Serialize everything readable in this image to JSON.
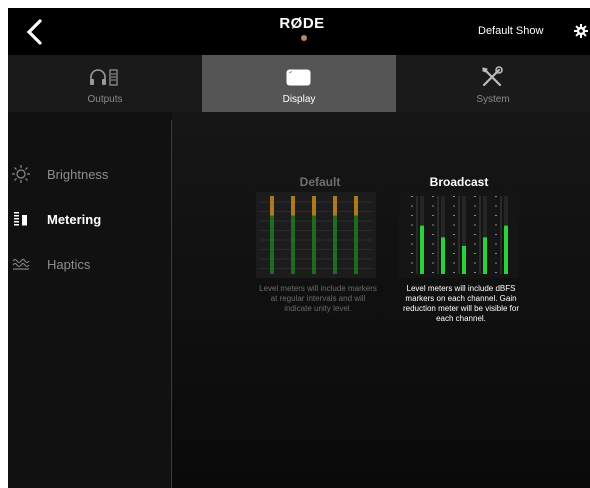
{
  "header": {
    "back_icon": "chevron-left-icon",
    "logo": "RØDE",
    "show_name": "Default Show",
    "settings_icon": "gear-icon",
    "accent": "#b8895a"
  },
  "tabs": [
    {
      "label": "Outputs",
      "icon": "headphones-output-icon"
    },
    {
      "label": "Display",
      "icon": "display-icon",
      "active": true
    },
    {
      "label": "System",
      "icon": "tools-icon"
    }
  ],
  "sidebar": {
    "items": [
      {
        "label": "Brightness",
        "icon": "brightness-icon"
      },
      {
        "label": "Metering",
        "icon": "metering-icon",
        "active": true
      },
      {
        "label": "Haptics",
        "icon": "haptics-icon"
      }
    ]
  },
  "metering": {
    "default": {
      "title": "Default",
      "description": "Level meters will include markers at regular intervals and will indicate unity level.",
      "levels": [
        1.0,
        1.0,
        1.0,
        1.0,
        1.0
      ]
    },
    "broadcast": {
      "title": "Broadcast",
      "description": "Level meters will include dBFS markers on each channel. Gain reduction meter will be visible for each channel.",
      "levels": [
        0.62,
        0.47,
        0.36,
        0.47,
        0.62
      ],
      "selected": true
    }
  },
  "colors": {
    "meter_green": "#28d33a",
    "meter_dim_green": "#1f6b1f",
    "meter_amber": "#b0781e",
    "active_tab_bg": "#555555"
  }
}
